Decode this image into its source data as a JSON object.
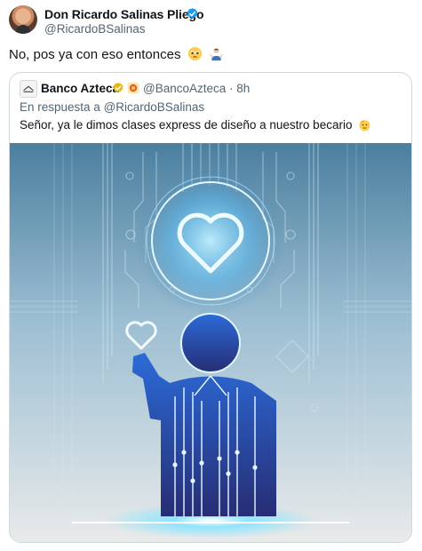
{
  "author": {
    "name": "Don Ricardo Salinas Pliego",
    "handle": "@RicardoBSalinas"
  },
  "tweet": {
    "text": "No, pos ya con eso entonces"
  },
  "quote": {
    "name": "Banco Azteca",
    "handle": "@BancoAzteca",
    "separator": "·",
    "time": "8h",
    "reply_prefix": "En respuesta a",
    "reply_to": "@RicardoBSalinas",
    "text": "Señor, ya le dimos clases express de diseño a nuestro becario"
  },
  "colors": {
    "verified_blue": "#1d9bf0",
    "verified_gold": "#e2b719",
    "muted_text": "#536471",
    "card_border": "#cfd9de",
    "art_figure": "#2a3f8a",
    "art_glow": "#7fd8ff"
  },
  "icons": {
    "author_verified": "verified-badge-icon",
    "emoji_1": "pleading-face-emoji",
    "emoji_2": "person-shrugging-emoji",
    "quote_logo": "banco-azteca-logo",
    "quote_verified": "gold-verified-badge-icon",
    "quote_affiliate": "affiliate-badge-icon",
    "quote_emoji": "saluting-face-emoji"
  },
  "image": {
    "subject": "ai-generated-illustration"
  }
}
